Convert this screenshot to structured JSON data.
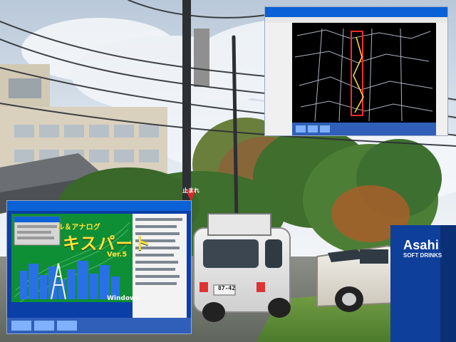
{
  "photo": {
    "description_tags": [
      "street",
      "utility-pole",
      "trees",
      "parked-cars",
      "building",
      "vending-machine"
    ]
  },
  "screenshot_top_right": {
    "type": "cad-map-window",
    "colors": {
      "bg": "#000000",
      "route": "#ff2b2b",
      "map_lines": "#bfc7d6",
      "taskbar": "#2f5fb9"
    }
  },
  "screenshot_bottom_left": {
    "type": "software-splash",
    "title_text": "ル＆アナログ",
    "main_text": "キスパート",
    "version": "Ver.5",
    "small_text": "Windows",
    "colors": {
      "bg": "#0f8f35",
      "text_yellow": "#ffe13a",
      "accent": "#1b57d8",
      "taskbar": "#2f5fb9"
    }
  },
  "signage": {
    "stop_sign": "止まれ",
    "vending_machine": {
      "brand": "Asahi",
      "subtitle": "SOFT DRINKS"
    }
  },
  "vehicles": {
    "van_plate": "87-42"
  }
}
